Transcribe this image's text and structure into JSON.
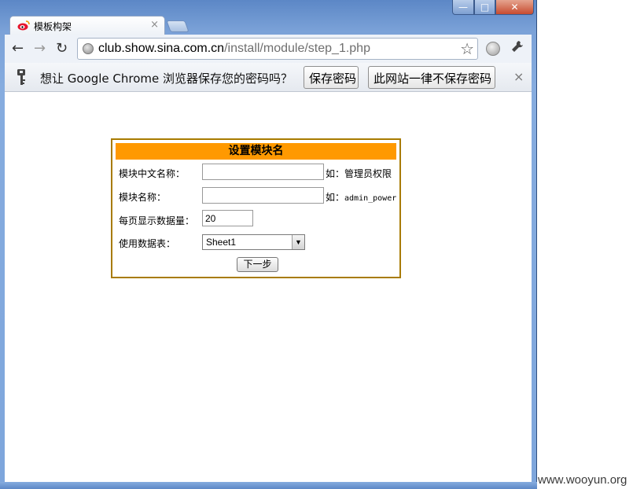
{
  "browser": {
    "tab": {
      "title": "模板构架",
      "close": "×"
    },
    "window_controls": {
      "minimize": "—",
      "maximize": "□",
      "close": "✕"
    },
    "toolbar": {
      "back": "←",
      "forward": "→",
      "reload": "↻",
      "url_host": "club.show.sina.com.cn",
      "url_path": "/install/module/step_1.php",
      "star": "☆",
      "wrench": "🔧"
    },
    "infobar": {
      "message": "想让 Google Chrome 浏览器保存您的密码吗？",
      "save_label": "保存密码",
      "never_label": "此网站一律不保存密码",
      "close": "×"
    }
  },
  "form": {
    "title": "设置模块名",
    "rows": [
      {
        "label": "模块中文名称：",
        "value": "",
        "hint": "如：管理员权限"
      },
      {
        "label": "模块名称：",
        "value": "",
        "hint_prefix": "如：",
        "hint_code": "admin_power"
      },
      {
        "label": "每页显示数据量：",
        "value": "20"
      },
      {
        "label": "使用数据表：",
        "selected": "Sheet1"
      }
    ],
    "next_label": "下一步"
  },
  "watermark": "www.wooyun.org",
  "colors": {
    "form_header": "#ff9900",
    "form_border": "#a87b00",
    "frame": "#7ba2d8"
  }
}
